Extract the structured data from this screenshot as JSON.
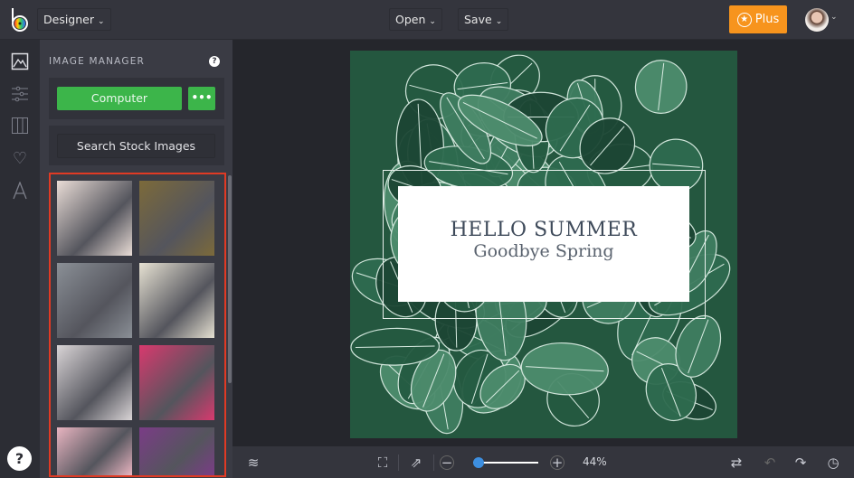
{
  "header": {
    "app_menu": "Designer",
    "open": "Open",
    "save": "Save",
    "plus": "Plus"
  },
  "sidebar_icons": [
    "image-icon",
    "sliders-icon",
    "columns-icon",
    "heart-icon",
    "text-icon"
  ],
  "panel": {
    "title": "IMAGE MANAGER",
    "computer_button": "Computer",
    "more_button": "•••",
    "stock_button": "Search Stock Images",
    "thumbnails": [
      {
        "name": "lace-dress",
        "color": "#e9dcd6"
      },
      {
        "name": "garden-wedding",
        "color": "#7c6a3a"
      },
      {
        "name": "wedding-couple",
        "color": "#8a8f96"
      },
      {
        "name": "bride-veil",
        "color": "#e6e1d2"
      },
      {
        "name": "bride-bouquet",
        "color": "#d9d4d6"
      },
      {
        "name": "flowers-woman",
        "color": "#d8396e"
      },
      {
        "name": "cherry-blossom",
        "color": "#e8b4c0"
      },
      {
        "name": "lilacs",
        "color": "#7a3c86"
      }
    ]
  },
  "canvas": {
    "headline": "HELLO SUMMER",
    "subline": "Goodbye Spring"
  },
  "bottom": {
    "zoom": "44%",
    "zoom_value": 0.1
  },
  "help": "?"
}
